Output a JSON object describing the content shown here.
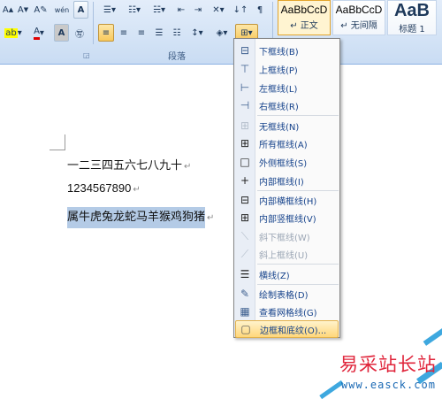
{
  "ribbon": {
    "row1_icons": [
      "font-grow-icon",
      "font-shrink-icon",
      "clear-format-icon",
      "phonetic-guide-icon",
      "char-border-icon",
      "bullets-icon",
      "numbering-icon",
      "multilevel-list-icon",
      "decrease-indent-icon",
      "increase-indent-icon",
      "asian-layout-icon",
      "sort-icon",
      "show-marks-icon"
    ],
    "row2_icons": [
      "highlight-icon",
      "font-color-icon",
      "char-shading-icon",
      "enclose-char-icon",
      "align-left-icon",
      "center-icon",
      "align-right-icon",
      "justify-icon",
      "distributed-icon",
      "line-spacing-icon",
      "shading-icon",
      "borders-icon"
    ],
    "paragraph_group_label": "段落",
    "styles": [
      {
        "sample": "AaBbCcD",
        "name": "↵ 正文",
        "selected": true
      },
      {
        "sample": "AaBbCcD",
        "name": "↵ 无间隔",
        "selected": false
      },
      {
        "sample": "AaB",
        "name": "标题 1",
        "selected": false
      }
    ],
    "accent_color": "#f8c95c"
  },
  "document": {
    "lines": [
      {
        "text": "一二三四五六七八九十",
        "mark": "↵",
        "selected": false
      },
      {
        "text": "1234567890",
        "mark": "↵",
        "selected": false
      },
      {
        "text": "属牛虎兔龙蛇马羊猴鸡狗猪",
        "mark": "↵",
        "selected": true
      }
    ],
    "selection_color": "#b4cbe6"
  },
  "border_menu": {
    "items": [
      {
        "label": "下框线(B)",
        "icon": "bottom-border-icon",
        "enabled": true
      },
      {
        "label": "上框线(P)",
        "icon": "top-border-icon",
        "enabled": true
      },
      {
        "label": "左框线(L)",
        "icon": "left-border-icon",
        "enabled": true
      },
      {
        "label": "右框线(R)",
        "icon": "right-border-icon",
        "enabled": true
      },
      {
        "label": "无框线(N)",
        "icon": "no-border-icon",
        "enabled": true
      },
      {
        "label": "所有框线(A)",
        "icon": "all-borders-icon",
        "enabled": true
      },
      {
        "label": "外侧框线(S)",
        "icon": "outside-borders-icon",
        "enabled": true
      },
      {
        "label": "内部框线(I)",
        "icon": "inside-borders-icon",
        "enabled": true
      },
      {
        "label": "内部横框线(H)",
        "icon": "inside-horizontal-border-icon",
        "enabled": true
      },
      {
        "label": "内部竖框线(V)",
        "icon": "inside-vertical-border-icon",
        "enabled": true
      },
      {
        "label": "斜下框线(W)",
        "icon": "diagonal-down-border-icon",
        "enabled": false
      },
      {
        "label": "斜上框线(U)",
        "icon": "diagonal-up-border-icon",
        "enabled": false
      },
      {
        "label": "横线(Z)",
        "icon": "horizontal-line-icon",
        "enabled": true
      },
      {
        "label": "绘制表格(D)",
        "icon": "draw-table-icon",
        "enabled": true
      },
      {
        "label": "查看网格线(G)",
        "icon": "view-gridlines-icon",
        "enabled": true
      },
      {
        "label": "边框和底纹(O)...",
        "icon": "borders-shading-icon",
        "enabled": true,
        "highlighted": true
      }
    ],
    "hover_color": "#ffd77b"
  },
  "watermark": {
    "title": "易采站长站",
    "url": "www.easck.com"
  }
}
